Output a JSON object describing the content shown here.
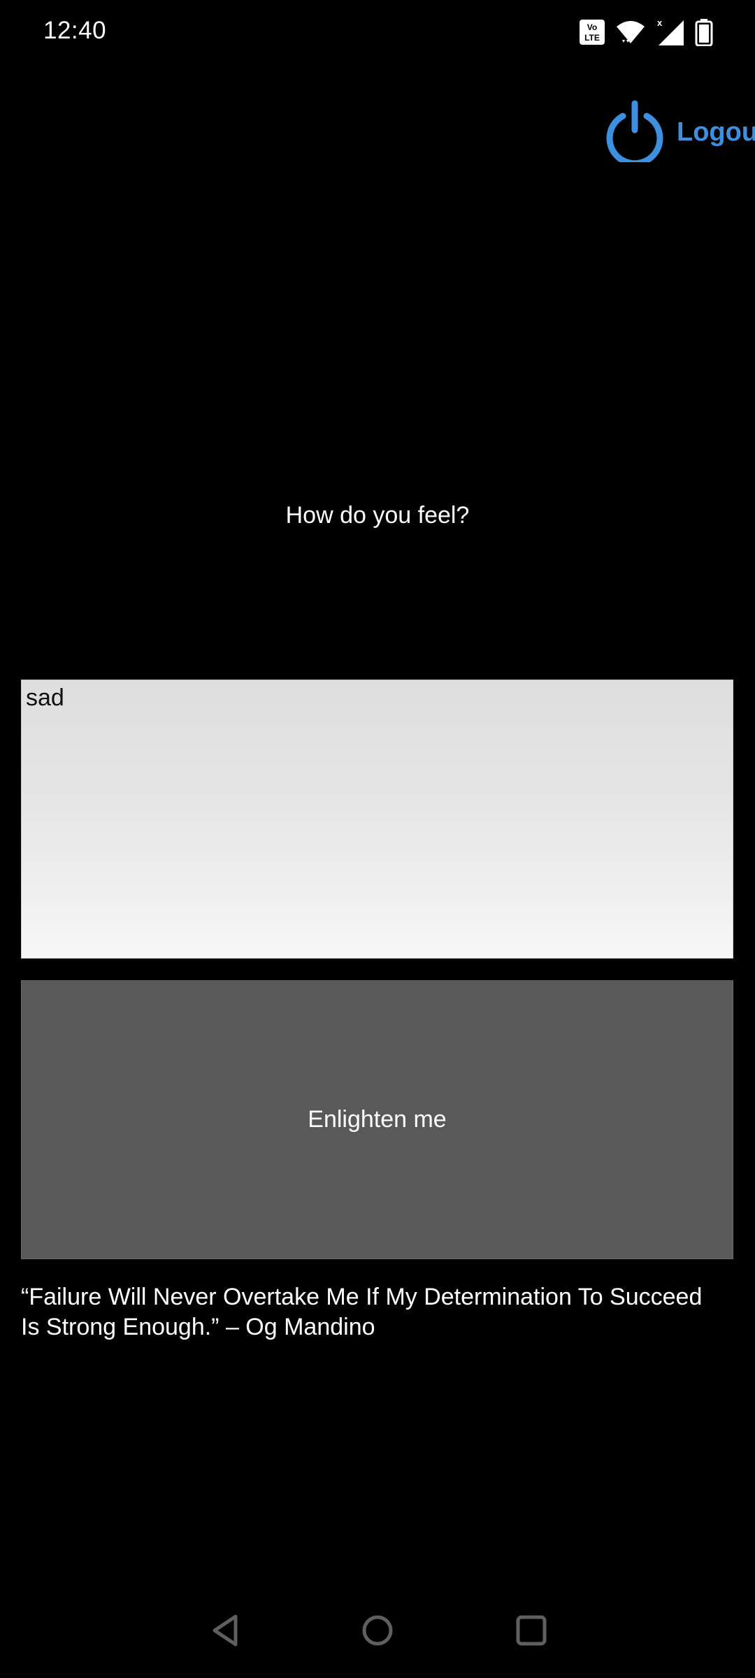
{
  "status_bar": {
    "time": "12:40",
    "icons": [
      "volte-icon",
      "wifi-icon",
      "cellular-signal-icon",
      "battery-icon"
    ]
  },
  "header": {
    "logout_label": "Logout",
    "logout_icon": "power-icon",
    "accent_color": "#3d8fdf"
  },
  "main": {
    "prompt": "How do you feel?",
    "mood_input_value": "sad",
    "submit_label": "Enlighten me",
    "quote": "“Failure Will Never Overtake Me If My Determination To Succeed Is Strong Enough.” – Og Mandino"
  },
  "nav_bar": {
    "buttons": [
      "back-icon",
      "home-icon",
      "recents-icon"
    ]
  }
}
